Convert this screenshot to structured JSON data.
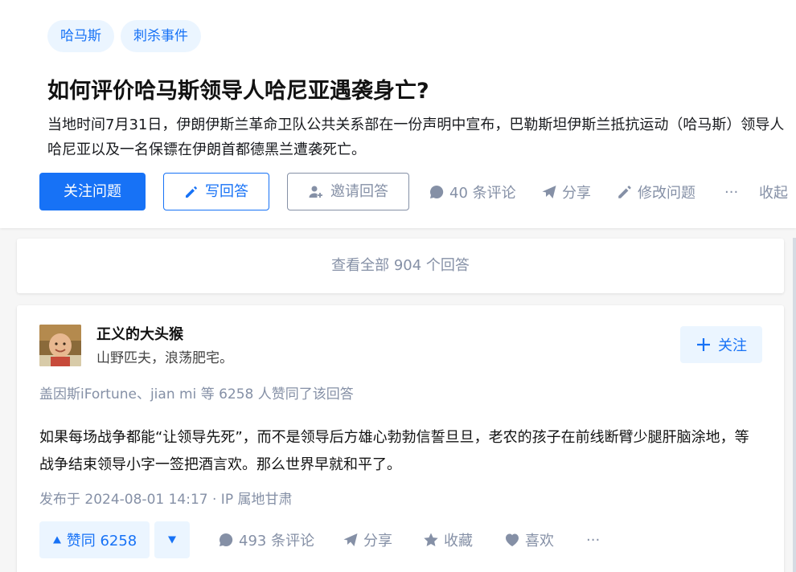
{
  "question": {
    "topics": [
      "哈马斯",
      "刺杀事件"
    ],
    "title": "如何评价哈马斯领导人哈尼亚遇袭身亡?",
    "detail": "当地时间7月31日，伊朗伊斯兰革命卫队公共关系部在一份声明中宣布，巴勒斯坦伊斯兰抵抗运动（哈马斯）领导人哈尼亚以及一名保镖在伊朗首都德黑兰遭袭死亡。",
    "actions": {
      "follow": "关注问题",
      "write_answer": "写回答",
      "invite": "邀请回答",
      "comments": "40 条评论",
      "share": "分享",
      "edit": "修改问题",
      "more": "···",
      "collapse": "收起"
    }
  },
  "view_all": "查看全部 904 个回答",
  "answer": {
    "author": {
      "name": "正义的大头猴",
      "bio": "山野匹夫，浪荡肥宅。",
      "follow_label": "关注"
    },
    "voters_text": "盖因斯iFortune、jian mi 等 6258 人赞同了该回答",
    "content": "如果每场战争都能“让领导先死”，而不是领导后方雄心勃勃信誓旦旦，老农的孩子在前线断臂少腿肝脑涂地，等战争结束领导小字一签把酒言欢。那么世界早就和平了。",
    "meta": "发布于 2024-08-01 14:17 · IP 属地甘肃",
    "actions": {
      "upvote": "赞同 6258",
      "comments": "493 条评论",
      "share": "分享",
      "collect": "收藏",
      "like": "喜欢",
      "more": "···"
    }
  },
  "colors": {
    "brand_blue": "#1772f6",
    "light_blue_bg": "#ebf5ff",
    "muted_gray": "#8590a6"
  }
}
